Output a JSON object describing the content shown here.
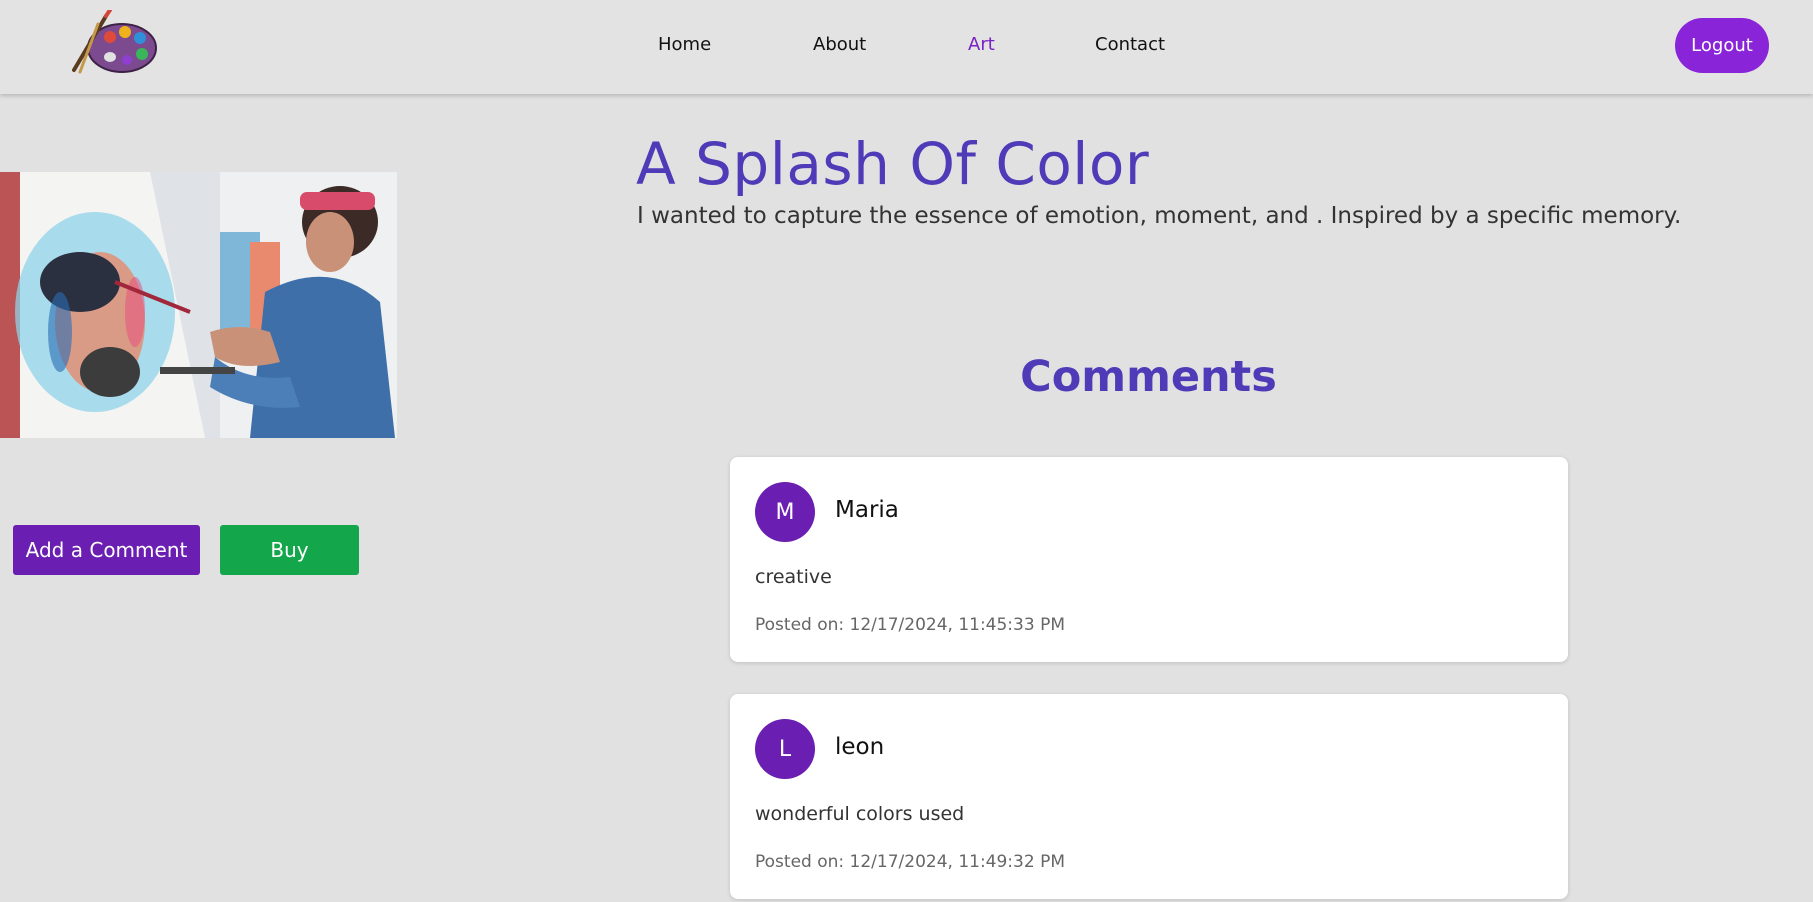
{
  "nav": {
    "logo_name": "palette-logo",
    "links": [
      {
        "label": "Home",
        "active": false
      },
      {
        "label": "About",
        "active": false
      },
      {
        "label": "Art",
        "active": true
      },
      {
        "label": "Contact",
        "active": false
      }
    ],
    "logout_label": "Logout"
  },
  "artwork": {
    "title": "A Splash Of Color",
    "description": "I wanted to capture the essence of emotion, moment, and . Inspired by a specific memory.",
    "image_name": "artist-painting-portrait-photo"
  },
  "actions": {
    "add_comment_label": "Add a Comment",
    "buy_label": "Buy"
  },
  "comments": {
    "heading": "Comments",
    "items": [
      {
        "initial": "M",
        "user": "Maria",
        "text": "creative",
        "posted": "Posted on: 12/17/2024, 11:45:33 PM"
      },
      {
        "initial": "L",
        "user": "leon",
        "text": "wonderful colors used",
        "posted": "Posted on: 12/17/2024, 11:49:32 PM"
      }
    ]
  },
  "colors": {
    "accent_purple": "#8a24d9",
    "title_purple": "#4f3bb8",
    "avatar_purple": "#6a1fb2",
    "buy_green": "#14a64a",
    "background": "#e1e1e1"
  }
}
